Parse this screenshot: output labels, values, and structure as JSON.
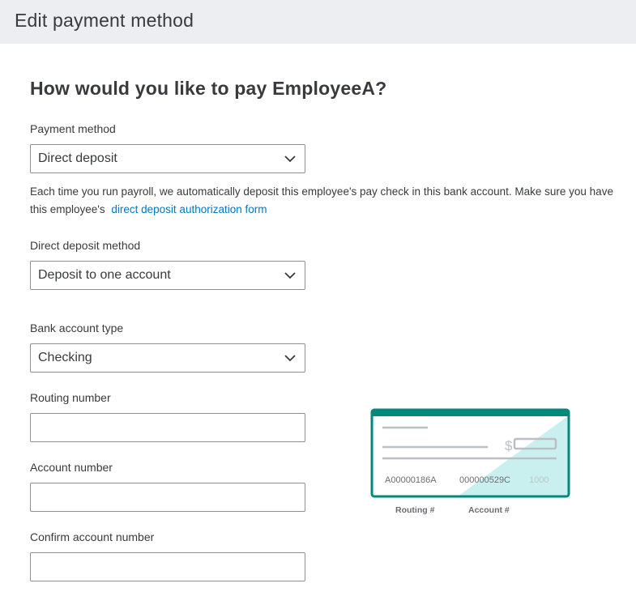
{
  "header": {
    "title": "Edit payment method"
  },
  "main": {
    "question": "How would you like to pay EmployeeA?",
    "payment_method": {
      "label": "Payment method",
      "value": "Direct deposit"
    },
    "help": {
      "text": "Each time you run payroll, we automatically deposit this employee's pay check in this bank account. Make sure you have this employee's",
      "link": "direct deposit authorization form"
    },
    "deposit_method": {
      "label": "Direct deposit method",
      "value": "Deposit to one account"
    },
    "account_type": {
      "label": "Bank account type",
      "value": "Checking"
    },
    "routing": {
      "label": "Routing number",
      "value": ""
    },
    "account": {
      "label": "Account number",
      "value": ""
    },
    "confirm_account": {
      "label": "Confirm account number",
      "value": ""
    }
  },
  "check_illustration": {
    "currency_symbol": "$",
    "routing_example": "A00000186A",
    "account_example": "000000529C",
    "check_number": "1000",
    "routing_caption": "Routing #",
    "account_caption": "Account #"
  },
  "colors": {
    "accent_teal": "#00897b",
    "link_blue": "#0077c5",
    "header_bg": "#eceef1"
  }
}
